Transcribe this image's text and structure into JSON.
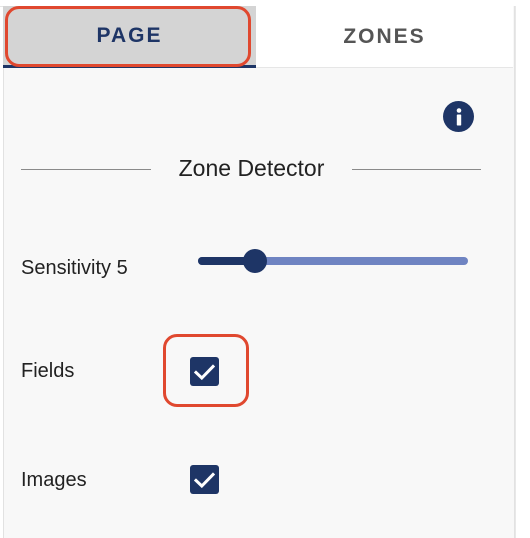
{
  "tabs": [
    {
      "label": "PAGE",
      "active": true
    },
    {
      "label": "ZONES",
      "active": false
    }
  ],
  "section": {
    "title": "Zone Detector",
    "info_icon": "info-icon"
  },
  "sensitivity": {
    "label": "Sensitivity 5",
    "value": 5,
    "min": 1,
    "max": 20
  },
  "options": [
    {
      "label": "Fields",
      "checked": true
    },
    {
      "label": "Images",
      "checked": true
    }
  ],
  "colors": {
    "accent": "#1e3566",
    "track": "#6f84c2",
    "highlight": "#e0482f",
    "active_tab_bg": "#d4d4d4"
  }
}
